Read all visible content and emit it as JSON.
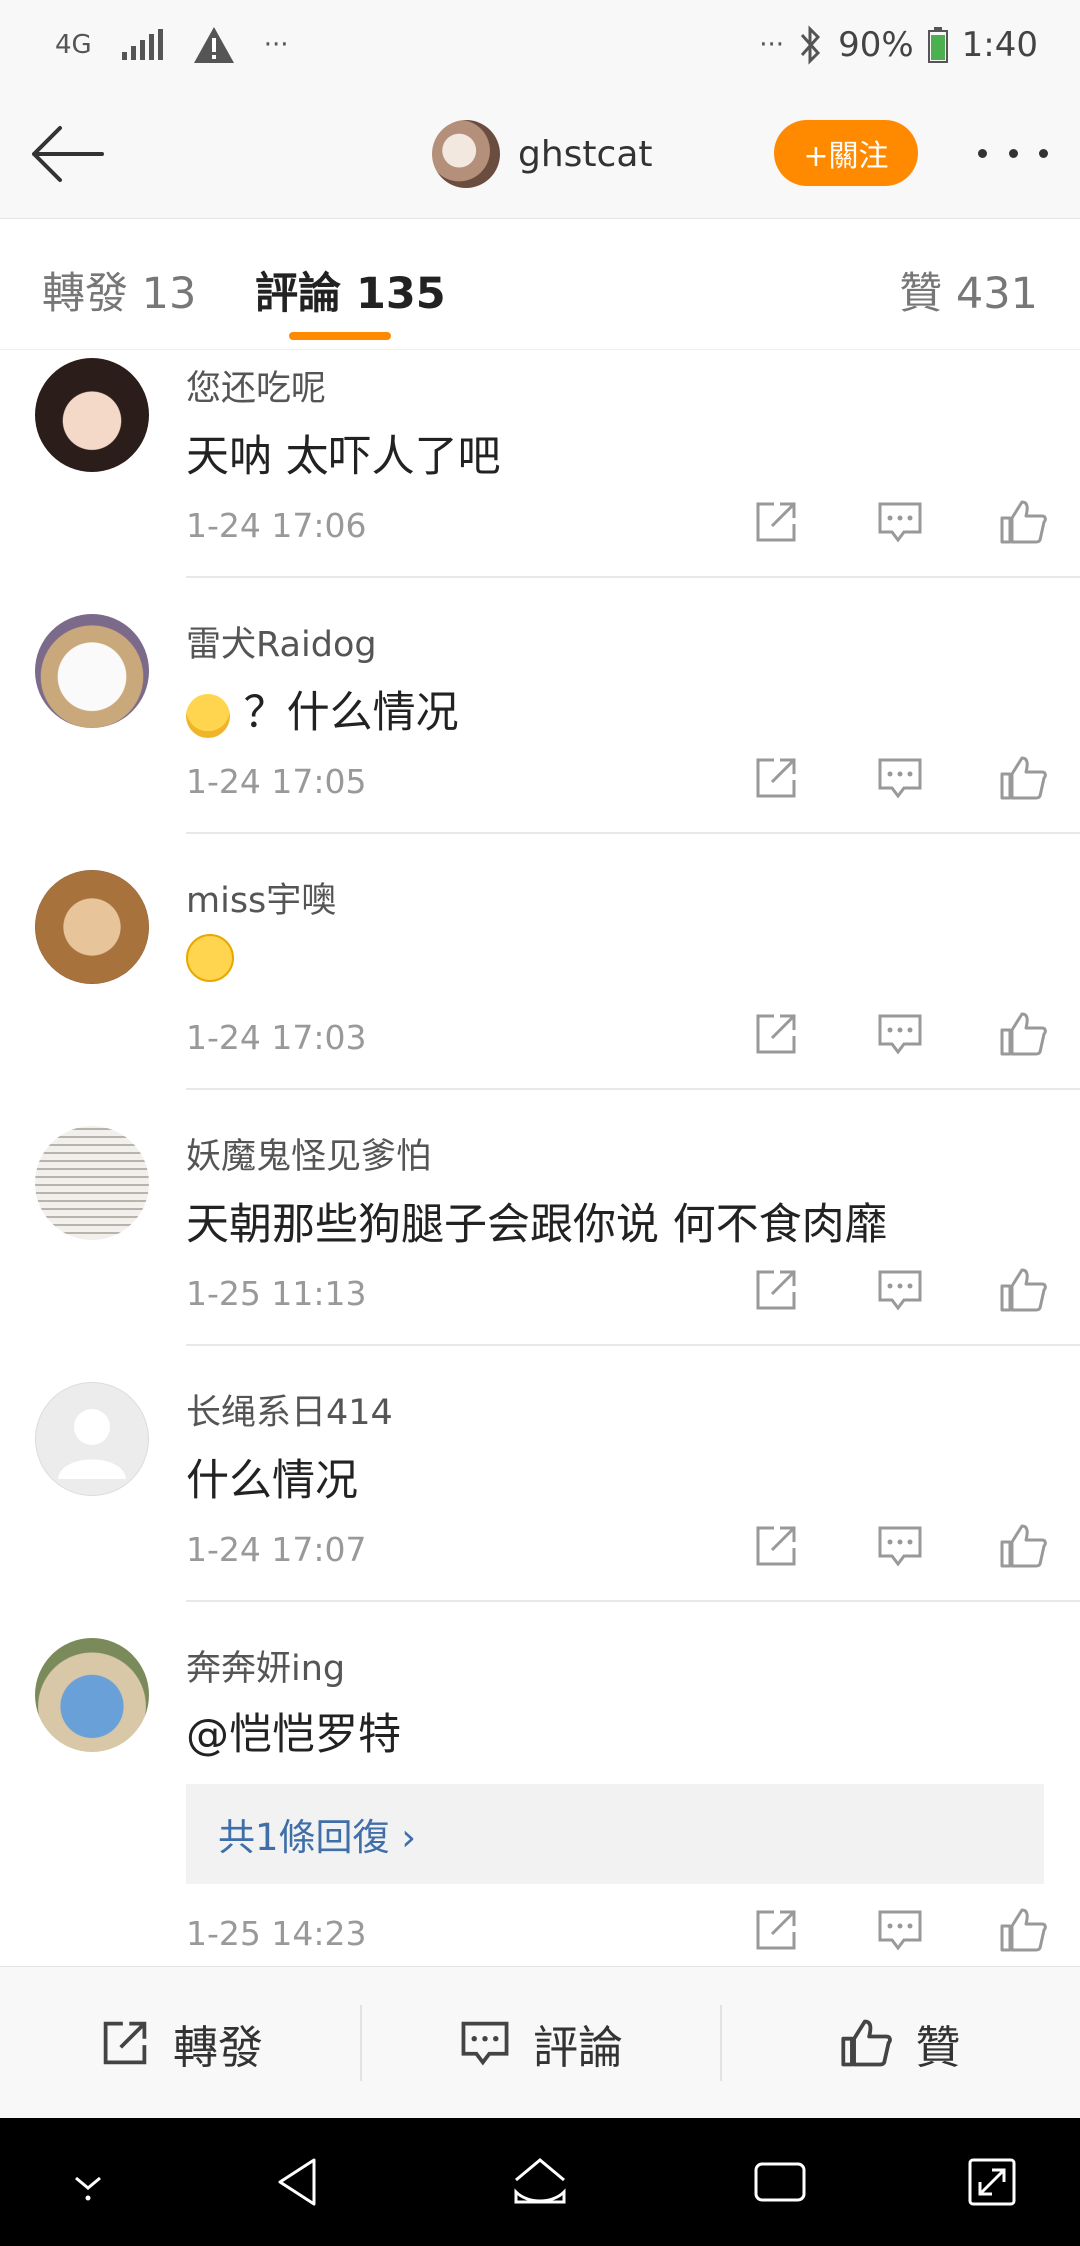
{
  "status_bar": {
    "network": "4G",
    "dots_left": "···",
    "dots_right": "···",
    "battery": "90%",
    "time": "1:40"
  },
  "header": {
    "username": "ghstcat",
    "follow_label": "+關注"
  },
  "tabs": {
    "repost": "轉發 13",
    "comments": "評論 135",
    "likes": "贊 431"
  },
  "comments": [
    {
      "name": "您还吃呢",
      "text": "天呐 太吓人了吧",
      "time": "1-24 17:06"
    },
    {
      "name": "雷犬Raidog",
      "text": "？什么情况",
      "time": "1-24 17:05"
    },
    {
      "name": "miss宇噢",
      "text": "",
      "time": "1-24 17:03"
    },
    {
      "name": "妖魔鬼怪见爹怕",
      "text": "天朝那些狗腿子会跟你说 何不食肉靡",
      "time": "1-25 11:13"
    },
    {
      "name": "长绳系日414",
      "text": "什么情况",
      "time": "1-24 17:07"
    },
    {
      "name": "奔奔妍ing",
      "text": "@恺恺罗特",
      "time": "1-25 14:23",
      "replies": "共1條回復 ›"
    }
  ],
  "action_bar": {
    "repost": "轉發",
    "comment": "評論",
    "like": "贊"
  },
  "colors": {
    "accent": "#ff8a00",
    "link": "#3f6ea8"
  }
}
